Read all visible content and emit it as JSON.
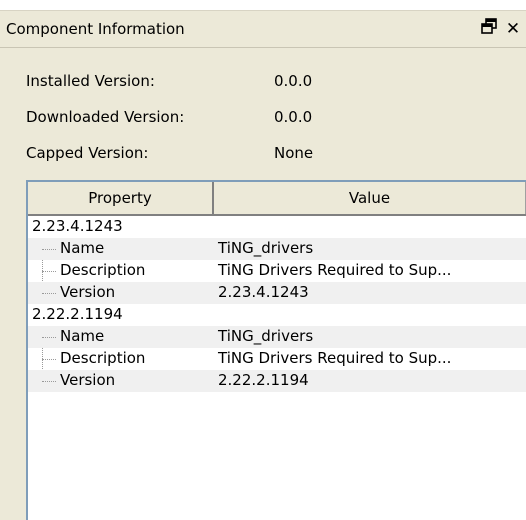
{
  "panel": {
    "title": "Component Information",
    "float_icon": "float-window-icon",
    "close_icon": "close-icon"
  },
  "info": {
    "installed_label": "Installed Version:",
    "installed_value": "0.0.0",
    "downloaded_label": "Downloaded Version:",
    "downloaded_value": "0.0.0",
    "capped_label": "Capped Version:",
    "capped_value": "None"
  },
  "grid": {
    "columns": [
      "Property",
      "Value"
    ],
    "groups": [
      {
        "label": "2.23.4.1243",
        "rows": [
          {
            "property": "Name",
            "value": "TiNG_drivers"
          },
          {
            "property": "Description",
            "value": "TiNG Drivers Required to Sup..."
          },
          {
            "property": "Version",
            "value": "2.23.4.1243"
          }
        ]
      },
      {
        "label": "2.22.2.1194",
        "rows": [
          {
            "property": "Name",
            "value": "TiNG_drivers"
          },
          {
            "property": "Description",
            "value": "TiNG Drivers Required to Sup..."
          },
          {
            "property": "Version",
            "value": "2.22.2.1194"
          }
        ]
      }
    ]
  },
  "colors": {
    "panel_bg": "#ece9d8",
    "grid_border": "#7f9db9",
    "alt_row": "#f0f0f0"
  }
}
